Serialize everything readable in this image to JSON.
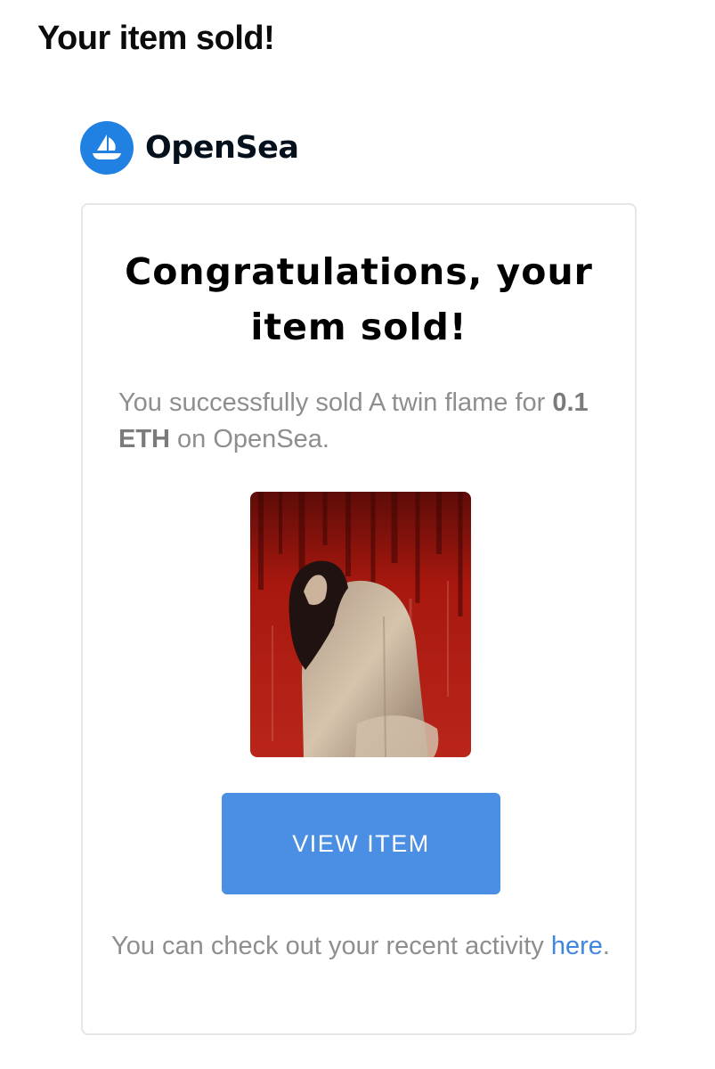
{
  "email": {
    "subject": "Your item sold!"
  },
  "brand": {
    "name": "OpenSea",
    "logo_icon": "sailboat-icon",
    "color": "#2081e2"
  },
  "card": {
    "title": "Congratulations, your item sold!",
    "description": {
      "prefix": "You successfully sold ",
      "item_name": "A twin flame",
      "mid": " for ",
      "price": "0.1 ETH",
      "suffix": " on OpenSea."
    },
    "image_icon": "artwork-image",
    "button_label": "VIEW ITEM",
    "button_color": "#4a8fe3",
    "footer_text": "You can check out your recent activity ",
    "footer_link": "here",
    "footer_end": "."
  }
}
